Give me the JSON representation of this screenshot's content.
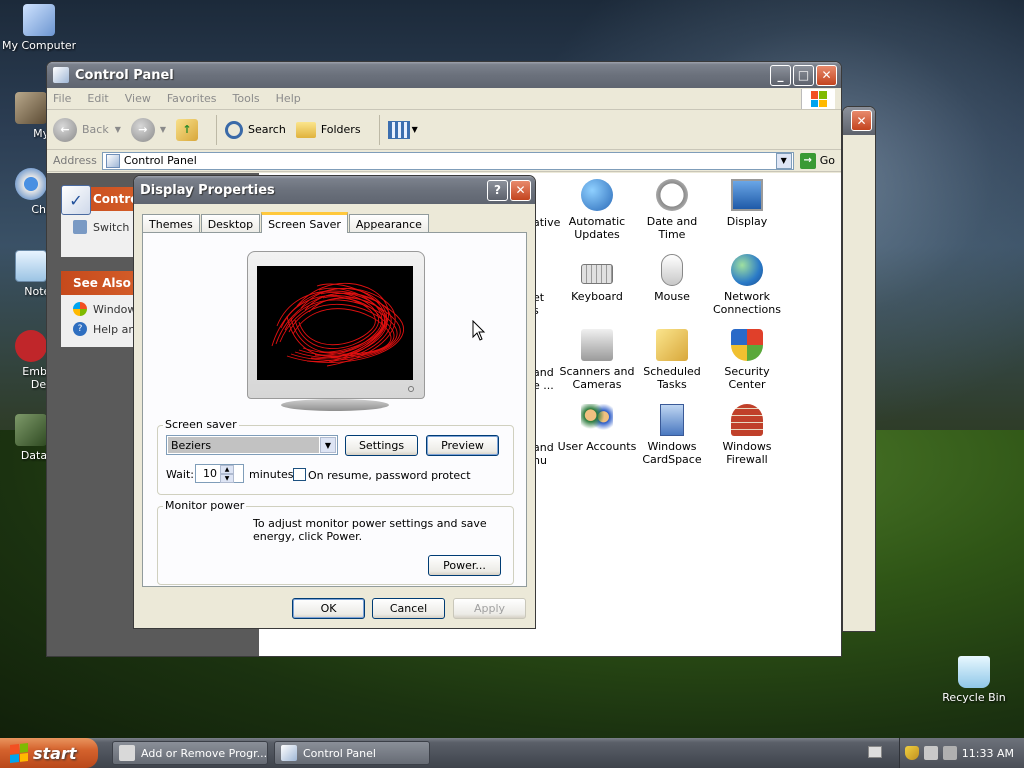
{
  "desktop": {
    "icons": [
      {
        "label": "My Computer"
      },
      {
        "label": "MyPa"
      },
      {
        "label": "Chron"
      },
      {
        "label": "Notepa"
      },
      {
        "label": "Embarc"
      },
      {
        "label": "Dev-C"
      },
      {
        "label": "DataWa"
      },
      {
        "label": "Recycle Bin"
      }
    ]
  },
  "control_panel": {
    "title": "Control Panel",
    "menu": [
      "File",
      "Edit",
      "View",
      "Favorites",
      "Tools",
      "Help"
    ],
    "toolbar": {
      "back": "Back",
      "search": "Search",
      "folders": "Folders"
    },
    "address_label": "Address",
    "address_value": "Control Panel",
    "go_label": "Go",
    "left_pane": {
      "control_head": "Contro",
      "switch_item": "Switch t",
      "see_also_head": "See Also",
      "see_also_items": [
        "Window",
        "Help an"
      ]
    },
    "cut_labels": [
      "ative",
      "et",
      "s",
      "and",
      "e ...",
      "and",
      "nu"
    ],
    "items": [
      {
        "label": "Automatic Updates"
      },
      {
        "label": "Date and Time"
      },
      {
        "label": "Display"
      },
      {
        "label": "Keyboard"
      },
      {
        "label": "Mouse"
      },
      {
        "label": "Network Connections"
      },
      {
        "label": "Scanners and Cameras"
      },
      {
        "label": "Scheduled Tasks"
      },
      {
        "label": "Security Center"
      },
      {
        "label": "User Accounts"
      },
      {
        "label": "Windows CardSpace"
      },
      {
        "label": "Windows Firewall"
      }
    ]
  },
  "display_properties": {
    "title": "Display Properties",
    "tabs": [
      "Themes",
      "Desktop",
      "Screen Saver",
      "Appearance"
    ],
    "active_tab": "Screen Saver",
    "screen_saver_group": "Screen saver",
    "screen_saver_value": "Beziers",
    "settings_button": "Settings",
    "preview_button": "Preview",
    "wait_label": "Wait:",
    "wait_value": "10",
    "minutes_label": "minutes",
    "password_label": "On resume, password protect",
    "monitor_group": "Monitor power",
    "monitor_text": "To adjust monitor power settings and save energy, click Power.",
    "power_button": "Power...",
    "ok_button": "OK",
    "cancel_button": "Cancel",
    "apply_button": "Apply"
  },
  "taskbar": {
    "start": "start",
    "tasks": [
      "Add or Remove Progr...",
      "Control Panel"
    ],
    "clock": "11:33 AM"
  },
  "colors": {
    "panel_header": "#c64a1c",
    "tab_highlight": "#ffc83c",
    "button_border": "#003c74",
    "bezier_stroke": "#e01010"
  }
}
